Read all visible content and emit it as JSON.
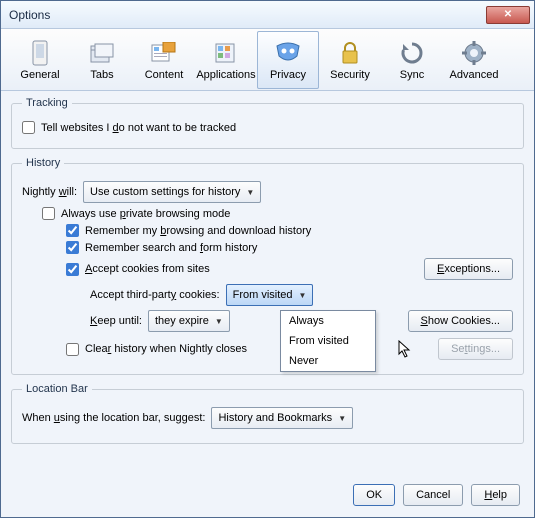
{
  "window": {
    "title": "Options"
  },
  "toolbar": {
    "items": [
      {
        "label": "General"
      },
      {
        "label": "Tabs"
      },
      {
        "label": "Content"
      },
      {
        "label": "Applications"
      },
      {
        "label": "Privacy"
      },
      {
        "label": "Security"
      },
      {
        "label": "Sync"
      },
      {
        "label": "Advanced"
      }
    ]
  },
  "tracking": {
    "legend": "Tracking",
    "dnt_label_pre": "Tell websites I ",
    "dnt_label_u": "d",
    "dnt_label_post": "o not want to be tracked"
  },
  "history": {
    "legend": "History",
    "will_pre": "Nightly ",
    "will_u": "w",
    "will_post": "ill:",
    "will_value": "Use custom settings for history",
    "private_pre": "Always use ",
    "private_u": "p",
    "private_post": "rivate browsing mode",
    "remember_browsing_pre": "Remember my ",
    "remember_browsing_u": "b",
    "remember_browsing_post": "rowsing and download history",
    "remember_form_pre": "Remember search and ",
    "remember_form_u": "f",
    "remember_form_post": "orm history",
    "accept_cookies_u": "A",
    "accept_cookies_post": "ccept cookies from sites",
    "exceptions_u": "E",
    "exceptions_post": "xceptions...",
    "third_party_pre": "Accept third-part",
    "third_party_u": "y",
    "third_party_post": " cookies:",
    "third_party_value": "From visited",
    "third_party_options": [
      "Always",
      "From visited",
      "Never"
    ],
    "keep_u": "K",
    "keep_post": "eep until:",
    "keep_value": "they expire",
    "show_cookies_u": "S",
    "show_cookies_post": "how Cookies...",
    "clear_pre": "Clea",
    "clear_u": "r",
    "clear_post": " history when Nightly closes",
    "settings_pre": "Se",
    "settings_u": "t",
    "settings_post": "tings..."
  },
  "location": {
    "legend": "Location Bar",
    "suggest_pre": "When ",
    "suggest_u": "u",
    "suggest_post": "sing the location bar, suggest:",
    "suggest_value": "History and Bookmarks"
  },
  "footer": {
    "ok": "OK",
    "cancel": "Cancel",
    "help_u": "H",
    "help_post": "elp"
  }
}
